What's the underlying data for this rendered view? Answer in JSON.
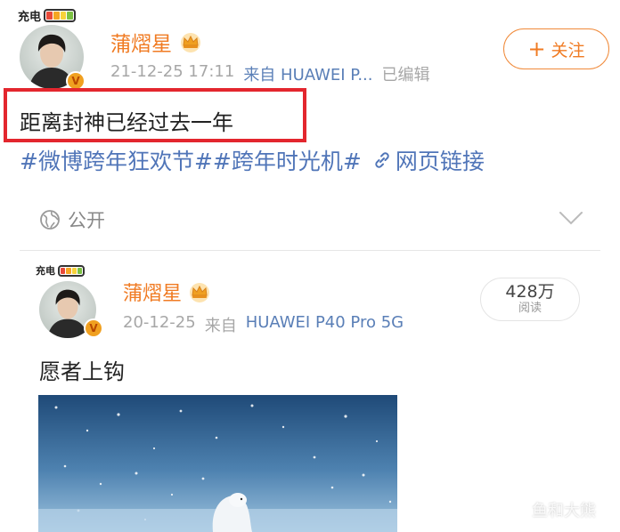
{
  "post": {
    "charge_label": "充电",
    "username": "蒲熠星",
    "verified_mark": "V",
    "date": "21-12-25 17:11",
    "source": "来自 HUAWEI P...",
    "edited": "已编辑",
    "follow_label": "关注",
    "text": "距离封神已经过去一年",
    "tags": [
      "#微博跨年狂欢节#",
      "#跨年时光机#"
    ],
    "web_link_label": "网页链接",
    "visibility": "公开"
  },
  "repost": {
    "charge_label": "充电",
    "username": "蒲熠星",
    "verified_mark": "V",
    "date": "20-12-25",
    "source_prefix": "来自",
    "source": "HUAWEI P40 Pro 5G",
    "views_count": "428万",
    "views_label": "阅读",
    "text": "愿者上钩"
  },
  "watermark": "鱼和大熊",
  "icons": {
    "crown": "crown-icon",
    "globe": "globe-icon",
    "chevron": "chevron-down-icon",
    "link": "link-icon",
    "plus": "plus-icon"
  },
  "colors": {
    "accent_orange": "#f07b23",
    "link_blue": "#5075b8",
    "highlight_red": "#e3262e",
    "meta_gray": "#a7a7a7"
  }
}
